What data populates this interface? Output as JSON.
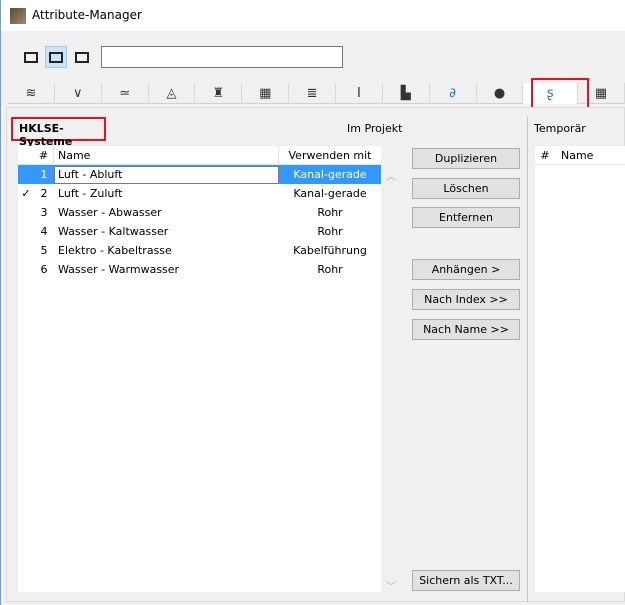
{
  "window": {
    "title": "Attribute-Manager"
  },
  "toolbar": {
    "view_buttons": [
      "left-panel-view-icon",
      "both-panels-view-icon",
      "right-panel-view-icon"
    ],
    "selected_view": 1,
    "search_value": ""
  },
  "tabs": [
    {
      "icon": "layers-icon",
      "glyph": "≋"
    },
    {
      "icon": "pen-icon",
      "glyph": "∨"
    },
    {
      "icon": "line-type-icon",
      "glyph": "≃"
    },
    {
      "icon": "fill-icon",
      "glyph": "◬"
    },
    {
      "icon": "surface-brush-icon",
      "glyph": "♜"
    },
    {
      "icon": "building-material-icon",
      "glyph": "▦"
    },
    {
      "icon": "composite-icon",
      "glyph": "≣"
    },
    {
      "icon": "profile-icon",
      "glyph": "I"
    },
    {
      "icon": "zone-category-icon",
      "glyph": "▙"
    },
    {
      "icon": "mep-curve-icon",
      "glyph": "∂"
    },
    {
      "icon": "globe-icon",
      "glyph": "●"
    },
    {
      "icon": "mep-system-icon",
      "glyph": "ʂ"
    },
    {
      "icon": "grid-icon",
      "glyph": "▦"
    }
  ],
  "selected_tab": 11,
  "left": {
    "section_title": "HKLSE-Systeme",
    "location_label": "Im Projekt",
    "columns": [
      "#",
      "Name",
      "Verwenden mit"
    ],
    "rows": [
      {
        "check": "",
        "index": "1",
        "name": "Luft - Abluft",
        "use_with": "Kanal-gerade",
        "selected": true,
        "editing": true
      },
      {
        "check": "✓",
        "index": "2",
        "name": "Luft - Zuluft",
        "use_with": "Kanal-gerade"
      },
      {
        "check": "",
        "index": "3",
        "name": "Wasser - Abwasser",
        "use_with": "Rohr"
      },
      {
        "check": "",
        "index": "4",
        "name": "Wasser - Kaltwasser",
        "use_with": "Rohr"
      },
      {
        "check": "",
        "index": "5",
        "name": "Elektro - Kabeltrasse",
        "use_with": "Kabelführung"
      },
      {
        "check": "",
        "index": "6",
        "name": "Wasser - Warmwasser",
        "use_with": "Rohr"
      }
    ]
  },
  "buttons": {
    "duplicate": "Duplizieren",
    "delete": "Löschen",
    "remove": "Entfernen",
    "append": "Anhängen >",
    "by_index": "Nach Index >>",
    "by_name": "Nach Name >>",
    "save_txt": "Sichern als TXT..."
  },
  "right": {
    "location_label": "Temporär",
    "columns": [
      "#",
      "Name"
    ]
  },
  "colors": {
    "selection": "#3399ff",
    "highlight_box": "#e81123"
  }
}
